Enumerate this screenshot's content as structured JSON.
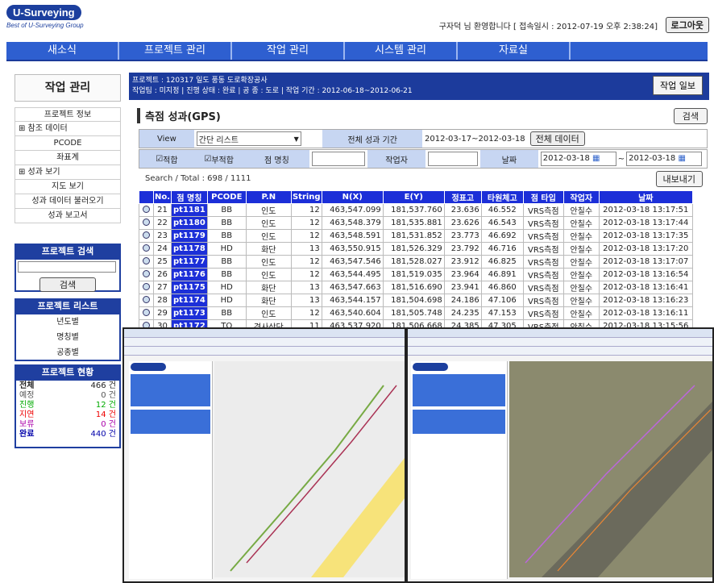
{
  "header": {
    "logo": "U-Surveying",
    "tagline": "Best of U-Surveying Group",
    "welcome": "구자덕 님 환영합니다 [ 접속일시 : 2012-07-19 오후 2:38:24]",
    "logout": "로그아웃"
  },
  "topnav": [
    "새소식",
    "프로젝트 관리",
    "작업 관리",
    "시스템 관리",
    "자료실"
  ],
  "sidebar": {
    "title": "작업 관리",
    "menu": [
      "프로젝트 정보",
      "⊞ 참조 데이터",
      "PCODE",
      "좌표계",
      "⊞ 성과 보기",
      "지도 보기",
      "성과 데이터 불러오기",
      "성과 보고서"
    ],
    "search_title": "프로젝트 검색",
    "search_btn": "검색",
    "list_title": "프로젝트 리스트",
    "list": [
      "년도별",
      "명칭별",
      "공종별"
    ],
    "status_title": "프로젝트 현황",
    "status": [
      {
        "label": "전체",
        "value": "466 건",
        "color": "#000"
      },
      {
        "label": "예정",
        "value": "0 건",
        "color": "#333"
      },
      {
        "label": "진행",
        "value": "12 건",
        "color": "#0a0"
      },
      {
        "label": "지연",
        "value": "14 건",
        "color": "#e00"
      },
      {
        "label": "보류",
        "value": "0 건",
        "color": "#a0a"
      },
      {
        "label": "완료",
        "value": "440 건",
        "color": "#00a"
      }
    ]
  },
  "project": {
    "line1": "프로젝트 : 120317 일도 풍동 도로확장공사",
    "line2": "작업팀 : 미지정 | 진행 상태 : 완료 | 공 종 : 도로 | 작업 기간 : 2012-06-18~2012-06-21",
    "work_btn": "작업 일보"
  },
  "section": {
    "title": "측점 성과(GPS)",
    "search_btn": "검색"
  },
  "filter": {
    "view_label": "View",
    "view_value": "간단 리스트",
    "period_label": "전체 성과 기간",
    "period_value": "2012-03-17~2012-03-18",
    "all_btn": "전체 데이터",
    "chk1": "적합",
    "chk2": "부적합",
    "name_label": "점 명칭",
    "worker_label": "작업자",
    "date_label": "날짜",
    "date_from": "2012-03-18",
    "date_to": "2012-03-18"
  },
  "search_total": "Search / Total :  698 / 1111",
  "export_btn": "내보내기",
  "table": {
    "headers": [
      "",
      "No.",
      "점 명칭",
      "PCODE",
      "P.N",
      "String",
      "N(X)",
      "E(Y)",
      "정표고",
      "타원체고",
      "점 타입",
      "작업자",
      "날짜"
    ],
    "rows": [
      [
        "21",
        "pt1181",
        "BB",
        "인도",
        "12",
        "463,547.099",
        "181,537.760",
        "23.636",
        "46.552",
        "VRS측점",
        "안칠수",
        "2012-03-18 13:17:51"
      ],
      [
        "22",
        "pt1180",
        "BB",
        "인도",
        "12",
        "463,548.379",
        "181,535.881",
        "23.626",
        "46.543",
        "VRS측점",
        "안칠수",
        "2012-03-18 13:17:44"
      ],
      [
        "23",
        "pt1179",
        "BB",
        "인도",
        "12",
        "463,548.591",
        "181,531.852",
        "23.773",
        "46.692",
        "VRS측점",
        "안칠수",
        "2012-03-18 13:17:35"
      ],
      [
        "24",
        "pt1178",
        "HD",
        "화단",
        "13",
        "463,550.915",
        "181,526.329",
        "23.792",
        "46.716",
        "VRS측점",
        "안칠수",
        "2012-03-18 13:17:20"
      ],
      [
        "25",
        "pt1177",
        "BB",
        "인도",
        "12",
        "463,547.546",
        "181,528.027",
        "23.912",
        "46.825",
        "VRS측점",
        "안칠수",
        "2012-03-18 13:17:07"
      ],
      [
        "26",
        "pt1176",
        "BB",
        "인도",
        "12",
        "463,544.495",
        "181,519.035",
        "23.964",
        "46.891",
        "VRS측점",
        "안칠수",
        "2012-03-18 13:16:54"
      ],
      [
        "27",
        "pt1175",
        "HD",
        "화단",
        "13",
        "463,547.663",
        "181,516.690",
        "23.941",
        "46.860",
        "VRS측점",
        "안칠수",
        "2012-03-18 13:16:41"
      ],
      [
        "28",
        "pt1174",
        "HD",
        "화단",
        "13",
        "463,544.157",
        "181,504.698",
        "24.186",
        "47.106",
        "VRS측점",
        "안칠수",
        "2012-03-18 13:16:23"
      ],
      [
        "29",
        "pt1173",
        "BB",
        "인도",
        "12",
        "463,540.604",
        "181,505.748",
        "24.235",
        "47.153",
        "VRS측점",
        "안칠수",
        "2012-03-18 13:16:11"
      ],
      [
        "30",
        "pt1172",
        "TO",
        "경사상단",
        "11",
        "463,537.920",
        "181,506.668",
        "24.385",
        "47.305",
        "VRS측점",
        "안칠수",
        "2012-03-18 13:15:56"
      ]
    ]
  }
}
